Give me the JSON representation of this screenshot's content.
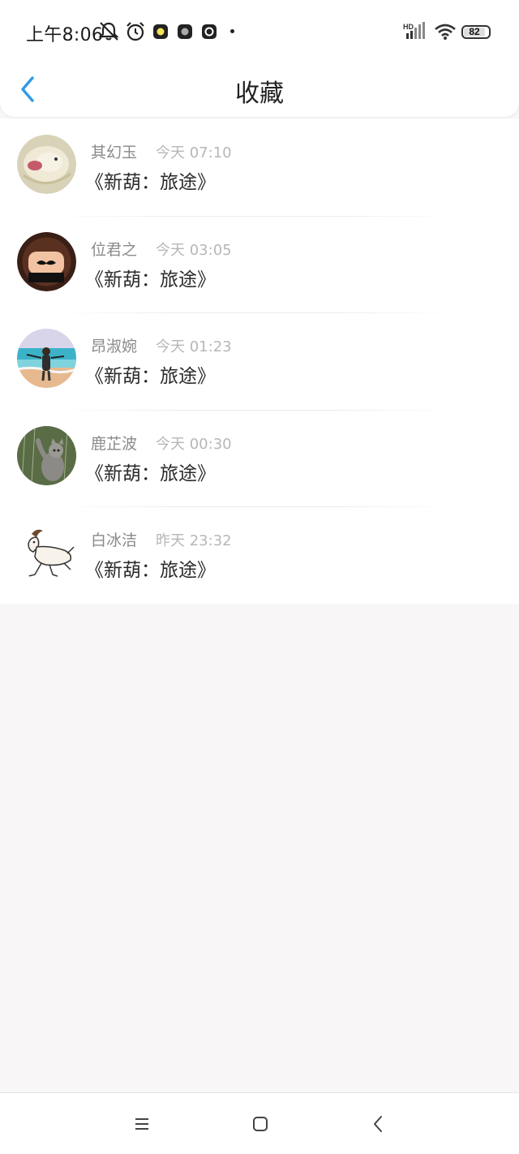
{
  "status_bar": {
    "time": "上午8:06",
    "battery": "82",
    "network_label": "HD"
  },
  "header": {
    "title": "收藏"
  },
  "favorites": [
    {
      "name": "其幻玉",
      "time": "今天 07:10",
      "book": "《新葫：旅途》",
      "avatar": "hamster-avatar"
    },
    {
      "name": "位君之",
      "time": "今天 03:05",
      "book": "《新葫：旅途》",
      "avatar": "fist-mustache-avatar"
    },
    {
      "name": "昂淑婉",
      "time": "今天 01:23",
      "book": "《新葫：旅途》",
      "avatar": "beach-girl-avatar"
    },
    {
      "name": "鹿芷波",
      "time": "今天 00:30",
      "book": "《新葫：旅途》",
      "avatar": "cat-rain-avatar"
    },
    {
      "name": "白冰洁",
      "time": "昨天 23:32",
      "book": "《新葫：旅途》",
      "avatar": "goat-drawing-avatar"
    }
  ],
  "colors": {
    "accent": "#2f9be7",
    "background": "#f8f6f7"
  }
}
